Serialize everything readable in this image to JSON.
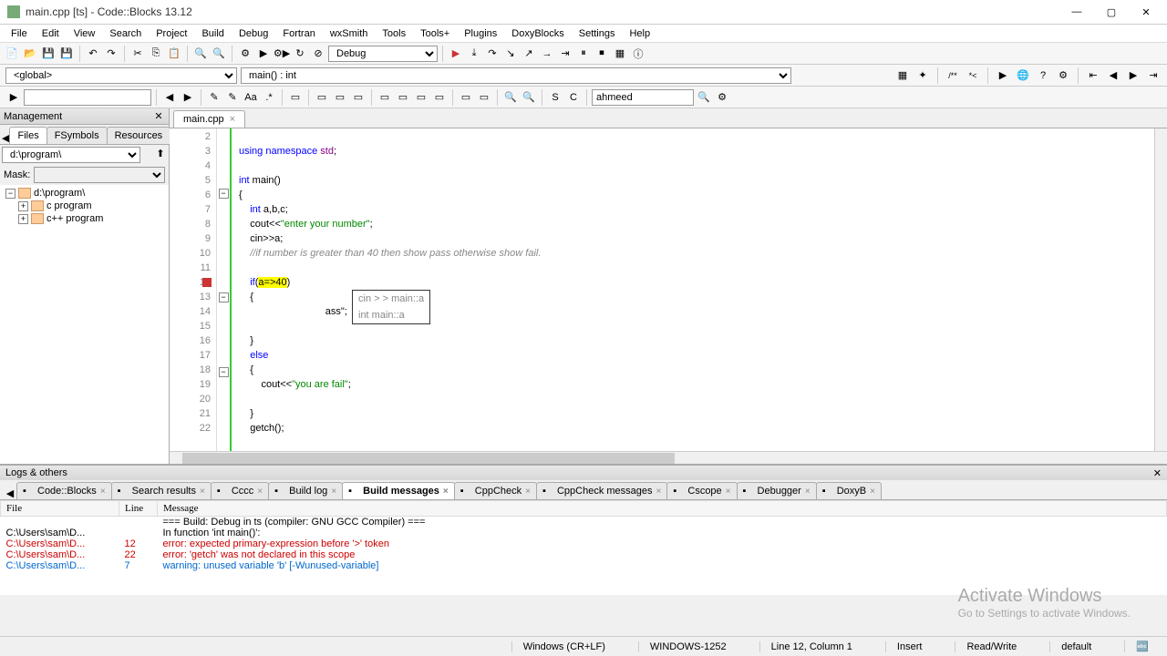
{
  "title": "main.cpp [ts] - Code::Blocks 13.12",
  "menus": [
    "File",
    "Edit",
    "View",
    "Search",
    "Project",
    "Build",
    "Debug",
    "Fortran",
    "wxSmith",
    "Tools",
    "Tools+",
    "Plugins",
    "DoxyBlocks",
    "Settings",
    "Help"
  ],
  "build_target": "Debug",
  "scope_combo": "<global>",
  "func_combo": "main() : int",
  "search_box": "ahmeed",
  "management": {
    "title": "Management",
    "tabs": [
      "Files",
      "FSymbols",
      "Resources"
    ],
    "active_tab": "Files",
    "path": "d:\\program\\",
    "mask_label": "Mask:",
    "tree": [
      {
        "label": "d:\\program\\"
      },
      {
        "label": "c program"
      },
      {
        "label": "c++ program"
      }
    ]
  },
  "editor": {
    "tab": "main.cpp",
    "lines": [
      {
        "n": 2,
        "html": ""
      },
      {
        "n": 3,
        "html": "<span class='kw'>using</span> <span class='kw'>namespace</span> <span class='ns'>std</span>;"
      },
      {
        "n": 4,
        "html": ""
      },
      {
        "n": 5,
        "html": "<span class='type'>int</span> main()"
      },
      {
        "n": 6,
        "html": "{",
        "fold": true
      },
      {
        "n": 7,
        "html": "    <span class='type'>int</span> a,b,c;"
      },
      {
        "n": 8,
        "html": "    cout&lt;&lt;<span class='str'>\"enter your number\"</span>;"
      },
      {
        "n": 9,
        "html": "    cin&gt;&gt;a;"
      },
      {
        "n": 10,
        "html": "    <span class='cmt'>//if number is greater than 40 then show pass otherwise show fail.</span>"
      },
      {
        "n": 11,
        "html": ""
      },
      {
        "n": 12,
        "html": "    <span class='kw'>if</span>(<span class='hl-yellow'>a=&gt;40</span>)",
        "bp": true
      },
      {
        "n": 13,
        "html": "    {",
        "fold": true
      },
      {
        "n": 14,
        "html": "                               ass\";"
      },
      {
        "n": 15,
        "html": ""
      },
      {
        "n": 16,
        "html": "    }"
      },
      {
        "n": 17,
        "html": "    <span class='kw'>else</span>"
      },
      {
        "n": 18,
        "html": "    {",
        "fold": true
      },
      {
        "n": 19,
        "html": "        cout&lt;&lt;<span class='str'>\"you are fail\"</span>;"
      },
      {
        "n": 20,
        "html": ""
      },
      {
        "n": 21,
        "html": "    }"
      },
      {
        "n": 22,
        "html": "    getch();"
      }
    ],
    "autocomplete": [
      "cin > > main::a",
      "int main::a"
    ]
  },
  "logs": {
    "title": "Logs & others",
    "tabs": [
      "Code::Blocks",
      "Search results",
      "Cccc",
      "Build log",
      "Build messages",
      "CppCheck",
      "CppCheck messages",
      "Cscope",
      "Debugger",
      "DoxyB"
    ],
    "active_tab": "Build messages",
    "columns": [
      "File",
      "Line",
      "Message"
    ],
    "rows": [
      {
        "file": "",
        "line": "",
        "msg": "=== Build: Debug in ts (compiler: GNU GCC Compiler) ===",
        "cls": ""
      },
      {
        "file": "C:\\Users\\sam\\D...",
        "line": "",
        "msg": "In function 'int main()':",
        "cls": ""
      },
      {
        "file": "C:\\Users\\sam\\D...",
        "line": "12",
        "msg": "error: expected primary-expression before '>' token",
        "cls": "err-row"
      },
      {
        "file": "C:\\Users\\sam\\D...",
        "line": "22",
        "msg": "error: 'getch' was not declared in this scope",
        "cls": "err-row"
      },
      {
        "file": "C:\\Users\\sam\\D...",
        "line": "7",
        "msg": "warning: unused variable 'b' [-Wunused-variable]",
        "cls": "warn-row"
      }
    ]
  },
  "statusbar": {
    "enc": "Windows (CR+LF)",
    "cp": "WINDOWS-1252",
    "pos": "Line 12, Column 1",
    "ins": "Insert",
    "rw": "Read/Write",
    "prof": "default"
  },
  "watermark": {
    "l1": "Activate Windows",
    "l2": "Go to Settings to activate Windows."
  }
}
